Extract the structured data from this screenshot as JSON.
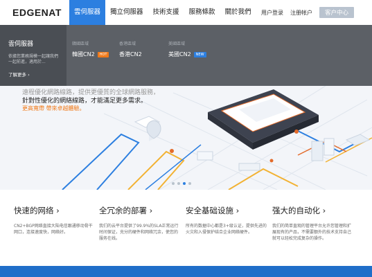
{
  "header": {
    "logo": "EDGENAT",
    "nav": [
      "雲伺服器",
      "獨立伺服器",
      "技術支援",
      "服務條款",
      "關於我們"
    ],
    "login": "用户登录",
    "register": "注册帐户",
    "console": "客户中心"
  },
  "dropdown": {
    "title": "雲伺服器",
    "description": "依據您業務規模一起讓我們一起前進，適用於...",
    "more": "了解更多 ›",
    "columns": [
      {
        "label": "韓國區域",
        "item": "韓國CN2",
        "badge": "HOT",
        "badge_color": "#f07a1a"
      },
      {
        "label": "香港區域",
        "item": "香港CN2",
        "badge": "",
        "badge_color": ""
      },
      {
        "label": "美國區域",
        "item": "美國CN2",
        "badge": "NEW",
        "badge_color": "#2c7fe0"
      }
    ]
  },
  "hero": {
    "line1": "遠程優化網路線路，提供更優質的全球網路服務，",
    "line2": "針對性優化的網絡線路，才能滿足更多需求。",
    "link": "更高寬帶 帶來卓越體驗。",
    "active_slide": 3,
    "slides": 4
  },
  "features": [
    {
      "title": "快速的网络",
      "desc": "CN2+BGP网络直接大陆电信跟通移动骨干网口，连接速度快，网络好。"
    },
    {
      "title": "全冗余的部署",
      "desc": "我们的云平台提供了99.9%的SLA正常运行时间保证，充分的硬件和网络冗余，使您的服务在线。"
    },
    {
      "title": "安全基础设施",
      "desc": "所有的数据中心都是3+级认证，提供先进的火灾和入侵保护结合企业网络硬件。"
    },
    {
      "title": "强大的自动化",
      "desc": "我们的简单直观的管理平台允许您管理和扩展现有的产品，不需要额外的技术支持自己就可以轻松完成复杂的操作。"
    }
  ],
  "colors": {
    "accent": "#2c7fe0",
    "orange": "#f07a1a"
  }
}
